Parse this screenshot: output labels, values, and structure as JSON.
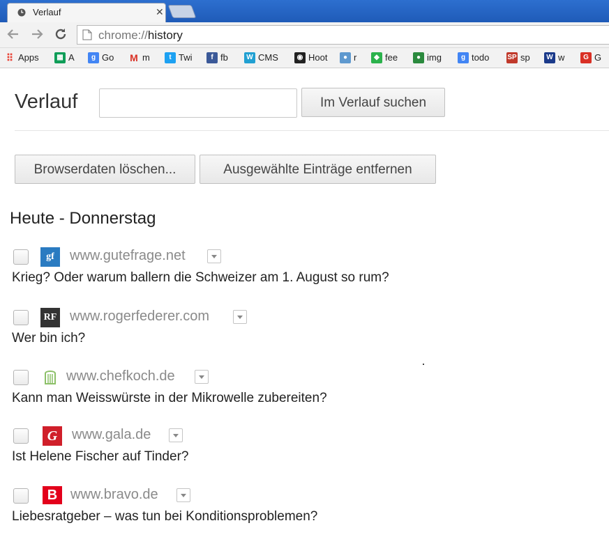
{
  "browser": {
    "tab_title": "Verlauf",
    "tab_close": "✕",
    "url_scheme": "chrome://",
    "url_host": "history",
    "accent_color": "#2d6fcf"
  },
  "bookmarks": [
    {
      "label": "Apps",
      "icon": "apps-grid-icon",
      "color": "#e94235"
    },
    {
      "label": "A",
      "icon": "sheets-icon",
      "color": "#0f9d58"
    },
    {
      "label": "Go",
      "icon": "google-icon",
      "color": "#4285f4"
    },
    {
      "label": "m",
      "icon": "gmail-icon",
      "color": "#d93025"
    },
    {
      "label": "Twi",
      "icon": "twitter-icon",
      "color": "#1da1f2"
    },
    {
      "label": "fb",
      "icon": "facebook-icon",
      "color": "#3b5998"
    },
    {
      "label": "CMS",
      "icon": "wordpress-icon",
      "color": "#21a0d2"
    },
    {
      "label": "Hoot",
      "icon": "hootsuite-owl-icon",
      "color": "#222222"
    },
    {
      "label": "r",
      "icon": "reddit-icon",
      "color": "#5f99cf"
    },
    {
      "label": "fee",
      "icon": "feedly-icon",
      "color": "#2bb24c"
    },
    {
      "label": "img",
      "icon": "img-circle-icon",
      "color": "#2b8a3e"
    },
    {
      "label": "todo",
      "icon": "google-icon",
      "color": "#4285f4"
    },
    {
      "label": "sp",
      "icon": "spon-icon",
      "color": "#c0392b"
    },
    {
      "label": "w",
      "icon": "w-icon",
      "color": "#1b3a8a"
    },
    {
      "label": "G",
      "icon": "g-red-icon",
      "color": "#d93025"
    }
  ],
  "page": {
    "title": "Verlauf",
    "search_button": "Im Verlauf suchen",
    "clear_button": "Browserdaten löschen...",
    "remove_button": "Ausgewählte Einträge entfernen",
    "day_heading": "Heute - Donnerstag"
  },
  "entries": [
    {
      "domain": "www.gutefrage.net",
      "title": "Krieg? Oder warum ballern die Schweizer am 1. August so rum?",
      "fav_text": "gf",
      "fav_icon": "gutefrage-icon",
      "fav_color": "#2a7bc1"
    },
    {
      "domain": "www.rogerfederer.com",
      "title": "Wer bin ich?",
      "fav_text": "RF",
      "fav_icon": "rogerfederer-icon",
      "fav_color": "#333333"
    },
    {
      "domain": "www.chefkoch.de",
      "title": "Kann man Weisswürste in der Mikrowelle zubereiten?",
      "fav_text": "",
      "fav_icon": "chefkoch-hat-icon",
      "fav_color": "#8cc068"
    },
    {
      "domain": "www.gala.de",
      "title": "Ist Helene Fischer auf Tinder?",
      "fav_text": "G",
      "fav_icon": "gala-icon",
      "fav_color": "#d01f2a"
    },
    {
      "domain": "www.bravo.de",
      "title": "Liebesratgeber – was tun bei Konditionsproblemen?",
      "fav_text": "B",
      "fav_icon": "bravo-icon",
      "fav_color": "#e3001b"
    }
  ]
}
